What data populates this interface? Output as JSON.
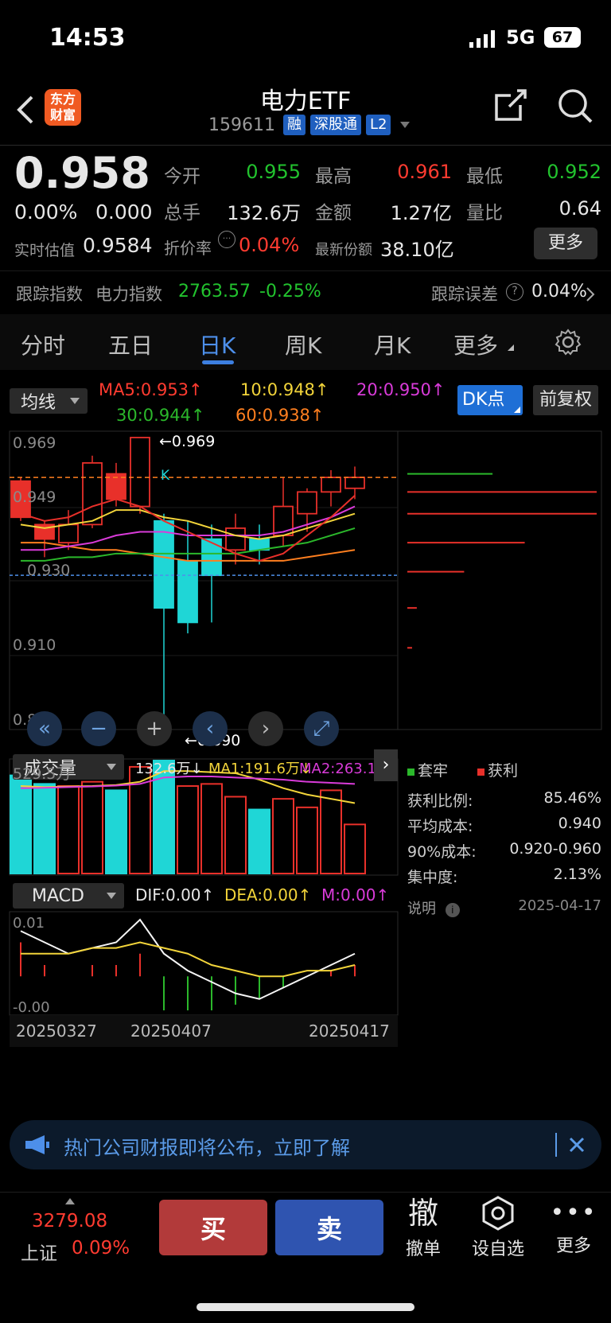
{
  "status_bar": {
    "time": "14:53",
    "network": "5G",
    "battery": "67"
  },
  "header": {
    "title": "电力ETF",
    "code": "159611",
    "tags": [
      "融",
      "深股通",
      "L2"
    ],
    "logo_text_1": "东方",
    "logo_text_2": "财富"
  },
  "quote": {
    "price": "0.958",
    "change_pct": "0.00%",
    "change": "0.000",
    "est_label": "实时估值",
    "est_value": "0.9584",
    "open_label": "今开",
    "open": "0.955",
    "high_label": "最高",
    "high": "0.961",
    "low_label": "最低",
    "low": "0.952",
    "vol_label": "总手",
    "vol": "132.6万",
    "amount_label": "金额",
    "amount": "1.27亿",
    "ratio_label": "量比",
    "ratio": "0.64",
    "premium_label": "折价率",
    "premium": "0.04%",
    "shares_label": "最新份额",
    "shares": "38.10亿",
    "more_label": "更多",
    "track_label": "跟踪指数",
    "index_name": "电力指数",
    "index_value": "2763.57",
    "index_change": "-0.25%",
    "track_err_label": "跟踪误差",
    "track_err": "0.04%"
  },
  "tabs": [
    "分时",
    "五日",
    "日K",
    "周K",
    "月K",
    "更多"
  ],
  "active_tab": "日K",
  "chart": {
    "ma_select": "均线",
    "ma5": "MA5:0.953↑",
    "ma10": "10:0.948↑",
    "ma20": "20:0.950↑",
    "ma30": "30:0.944↑",
    "ma60": "60:0.938↑",
    "dk_label": "DK点",
    "adjust_label": "前复权",
    "y_labels": [
      "0.969",
      "0.949",
      "0.930",
      "0.910",
      "0.890"
    ],
    "max_note": "←0.969",
    "min_note": "←0.890",
    "k_marker": "K",
    "vol_select": "成交量",
    "vol_value": "132.6万↓",
    "vol_ma1": "MA1:191.6万↓",
    "vol_ma2": "MA2:263.1万",
    "vol_max": "529.5万",
    "macd_select": "MACD",
    "dif": "DIF:0.00↑",
    "dea": "DEA:0.00↑",
    "m": "M:0.00↑",
    "macd_top": "0.01",
    "macd_bottom": "-0.00",
    "dates": [
      "20250327",
      "20250407",
      "20250417"
    ],
    "colors": {
      "up": "#e8302a",
      "down": "#1fd6d6",
      "ma5": "#f5f5f5",
      "ma10": "#f2d43a",
      "ma20": "#d93bd9",
      "ma30": "#2bb82b",
      "ma60": "#ff7f1f"
    }
  },
  "chart_data": {
    "type": "candlestick",
    "candles": [
      {
        "o": 0.947,
        "c": 0.957,
        "h": 0.958,
        "l": 0.946,
        "dir": "up"
      },
      {
        "o": 0.941,
        "c": 0.945,
        "h": 0.946,
        "l": 0.936,
        "dir": "up"
      },
      {
        "o": 0.94,
        "c": 0.945,
        "h": 0.949,
        "l": 0.938,
        "dir": "up"
      },
      {
        "o": 0.945,
        "c": 0.962,
        "h": 0.964,
        "l": 0.944,
        "dir": "up"
      },
      {
        "o": 0.952,
        "c": 0.959,
        "h": 0.962,
        "l": 0.95,
        "dir": "up"
      },
      {
        "o": 0.95,
        "c": 0.969,
        "h": 0.969,
        "l": 0.948,
        "dir": "up"
      },
      {
        "o": 0.946,
        "c": 0.922,
        "h": 0.948,
        "l": 0.89,
        "dir": "down"
      },
      {
        "o": 0.935,
        "c": 0.918,
        "h": 0.946,
        "l": 0.915,
        "dir": "down"
      },
      {
        "o": 0.941,
        "c": 0.931,
        "h": 0.945,
        "l": 0.918,
        "dir": "down"
      },
      {
        "o": 0.938,
        "c": 0.944,
        "h": 0.948,
        "l": 0.934,
        "dir": "up"
      },
      {
        "o": 0.938,
        "c": 0.941,
        "h": 0.945,
        "l": 0.934,
        "dir": "down"
      },
      {
        "o": 0.942,
        "c": 0.95,
        "h": 0.958,
        "l": 0.939,
        "dir": "up"
      },
      {
        "o": 0.948,
        "c": 0.954,
        "h": 0.955,
        "l": 0.943,
        "dir": "up"
      },
      {
        "o": 0.954,
        "c": 0.958,
        "h": 0.96,
        "l": 0.95,
        "dir": "up"
      },
      {
        "o": 0.955,
        "c": 0.958,
        "h": 0.961,
        "l": 0.952,
        "dir": "up"
      }
    ],
    "ma5": [
      0.948,
      0.946,
      0.947,
      0.95,
      0.952,
      0.95,
      0.946,
      0.943,
      0.94,
      0.937,
      0.935,
      0.937,
      0.942,
      0.947,
      0.953
    ],
    "ma10": [
      0.945,
      0.944,
      0.945,
      0.946,
      0.949,
      0.949,
      0.947,
      0.946,
      0.944,
      0.942,
      0.941,
      0.942,
      0.944,
      0.946,
      0.948
    ],
    "ma20": [
      0.938,
      0.938,
      0.939,
      0.94,
      0.942,
      0.943,
      0.943,
      0.942,
      0.942,
      0.942,
      0.942,
      0.943,
      0.945,
      0.947,
      0.95
    ],
    "ma30": [
      0.935,
      0.935,
      0.936,
      0.936,
      0.937,
      0.937,
      0.937,
      0.937,
      0.937,
      0.937,
      0.938,
      0.939,
      0.94,
      0.942,
      0.944
    ],
    "ma60": [
      0.94,
      0.94,
      0.939,
      0.938,
      0.938,
      0.937,
      0.936,
      0.935,
      0.935,
      0.935,
      0.935,
      0.935,
      0.936,
      0.937,
      0.938
    ],
    "ylim": [
      0.89,
      0.969
    ],
    "volume": [
      460,
      420,
      410,
      430,
      390,
      500,
      529.5,
      410,
      420,
      360,
      300,
      350,
      310,
      390,
      230
    ],
    "vol_dir": [
      "down",
      "down",
      "up",
      "up",
      "down",
      "up",
      "down",
      "up",
      "up",
      "up",
      "down",
      "up",
      "up",
      "up",
      "up"
    ],
    "vol_ma1": [
      410,
      405,
      408,
      410,
      415,
      430,
      480,
      480,
      475,
      470,
      440,
      400,
      370,
      350,
      330
    ],
    "vol_ma2": [
      400,
      402,
      405,
      408,
      412,
      420,
      450,
      455,
      455,
      450,
      445,
      440,
      430,
      425,
      420
    ],
    "dif": [
      0.008,
      0.006,
      0.004,
      0.005,
      0.006,
      0.01,
      0.004,
      0.001,
      -0.001,
      -0.003,
      -0.004,
      -0.002,
      0.0,
      0.002,
      0.004
    ],
    "dea": [
      0.004,
      0.004,
      0.004,
      0.005,
      0.005,
      0.006,
      0.005,
      0.004,
      0.002,
      0.001,
      0.0,
      0.0,
      0.001,
      0.001,
      0.002
    ],
    "macd_bar": [
      0.006,
      0.002,
      0.0,
      0.002,
      0.002,
      0.004,
      -0.006,
      -0.006,
      -0.006,
      -0.005,
      -0.004,
      -0.002,
      0.0,
      0.001,
      0.002
    ]
  },
  "chips": {
    "legend_lock": "套牢",
    "legend_profit": "获利",
    "profit_ratio_label": "获利比例:",
    "profit_ratio": "85.46%",
    "avg_cost_label": "平均成本:",
    "avg_cost": "0.940",
    "cost90_label": "90%成本:",
    "cost90": "0.920-0.960",
    "concentration_label": "集中度:",
    "concentration": "2.13%",
    "note_label": "说明",
    "date": "2025-04-17",
    "bars": [
      {
        "y": 0.959,
        "len": 0.45,
        "color": "#2bb82b"
      },
      {
        "y": 0.954,
        "len": 1.0,
        "color": "#e8302a"
      },
      {
        "y": 0.948,
        "len": 1.0,
        "color": "#e8302a"
      },
      {
        "y": 0.94,
        "len": 0.62,
        "color": "#e8302a"
      },
      {
        "y": 0.932,
        "len": 0.3,
        "color": "#e8302a"
      },
      {
        "y": 0.922,
        "len": 0.05,
        "color": "#e8302a"
      },
      {
        "y": 0.911,
        "len": 0.025,
        "color": "#e8302a"
      }
    ]
  },
  "banner": {
    "text": "热门公司财报即将公布，立即了解"
  },
  "bottom_bar": {
    "index_value": "3279.08",
    "index_name": "上证",
    "index_change": "0.09%",
    "buy": "买",
    "sell": "卖",
    "cancel_big": "撤",
    "cancel": "撤单",
    "watch": "设自选",
    "more": "更多"
  }
}
